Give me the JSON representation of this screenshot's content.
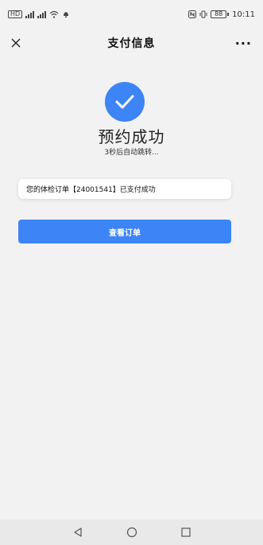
{
  "status_bar": {
    "time": "10:11",
    "battery": "88",
    "sim1": "HD",
    "sim2": "HD",
    "icons_left": [
      "hd-icon",
      "signal-icon",
      "signal-icon",
      "wifi-icon",
      "notification-icon"
    ],
    "icons_right": [
      "nfc-icon",
      "vibrate-icon",
      "battery-icon"
    ]
  },
  "header": {
    "title": "支付信息",
    "close_icon": "close-icon",
    "more_label": "···"
  },
  "success": {
    "title": "预约成功",
    "redirect_text": "3秒后自动跳转...",
    "accent_color": "#3D84F7"
  },
  "info_card": {
    "message": "您的体检订单【24001541】已支付成功"
  },
  "actions": {
    "view_order_label": "查看订单"
  },
  "nav_bar": {
    "items": [
      "back-icon",
      "home-icon",
      "recents-icon"
    ]
  }
}
